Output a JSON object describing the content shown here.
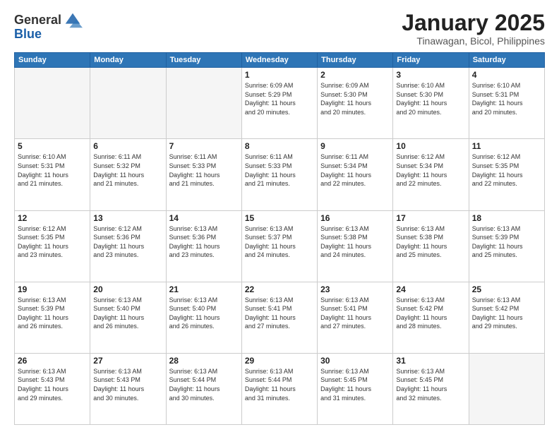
{
  "header": {
    "logo_general": "General",
    "logo_blue": "Blue",
    "month_title": "January 2025",
    "location": "Tinawagan, Bicol, Philippines"
  },
  "weekdays": [
    "Sunday",
    "Monday",
    "Tuesday",
    "Wednesday",
    "Thursday",
    "Friday",
    "Saturday"
  ],
  "weeks": [
    [
      {
        "day": "",
        "info": ""
      },
      {
        "day": "",
        "info": ""
      },
      {
        "day": "",
        "info": ""
      },
      {
        "day": "1",
        "info": "Sunrise: 6:09 AM\nSunset: 5:29 PM\nDaylight: 11 hours\nand 20 minutes."
      },
      {
        "day": "2",
        "info": "Sunrise: 6:09 AM\nSunset: 5:30 PM\nDaylight: 11 hours\nand 20 minutes."
      },
      {
        "day": "3",
        "info": "Sunrise: 6:10 AM\nSunset: 5:30 PM\nDaylight: 11 hours\nand 20 minutes."
      },
      {
        "day": "4",
        "info": "Sunrise: 6:10 AM\nSunset: 5:31 PM\nDaylight: 11 hours\nand 20 minutes."
      }
    ],
    [
      {
        "day": "5",
        "info": "Sunrise: 6:10 AM\nSunset: 5:31 PM\nDaylight: 11 hours\nand 21 minutes."
      },
      {
        "day": "6",
        "info": "Sunrise: 6:11 AM\nSunset: 5:32 PM\nDaylight: 11 hours\nand 21 minutes."
      },
      {
        "day": "7",
        "info": "Sunrise: 6:11 AM\nSunset: 5:33 PM\nDaylight: 11 hours\nand 21 minutes."
      },
      {
        "day": "8",
        "info": "Sunrise: 6:11 AM\nSunset: 5:33 PM\nDaylight: 11 hours\nand 21 minutes."
      },
      {
        "day": "9",
        "info": "Sunrise: 6:11 AM\nSunset: 5:34 PM\nDaylight: 11 hours\nand 22 minutes."
      },
      {
        "day": "10",
        "info": "Sunrise: 6:12 AM\nSunset: 5:34 PM\nDaylight: 11 hours\nand 22 minutes."
      },
      {
        "day": "11",
        "info": "Sunrise: 6:12 AM\nSunset: 5:35 PM\nDaylight: 11 hours\nand 22 minutes."
      }
    ],
    [
      {
        "day": "12",
        "info": "Sunrise: 6:12 AM\nSunset: 5:35 PM\nDaylight: 11 hours\nand 23 minutes."
      },
      {
        "day": "13",
        "info": "Sunrise: 6:12 AM\nSunset: 5:36 PM\nDaylight: 11 hours\nand 23 minutes."
      },
      {
        "day": "14",
        "info": "Sunrise: 6:13 AM\nSunset: 5:36 PM\nDaylight: 11 hours\nand 23 minutes."
      },
      {
        "day": "15",
        "info": "Sunrise: 6:13 AM\nSunset: 5:37 PM\nDaylight: 11 hours\nand 24 minutes."
      },
      {
        "day": "16",
        "info": "Sunrise: 6:13 AM\nSunset: 5:38 PM\nDaylight: 11 hours\nand 24 minutes."
      },
      {
        "day": "17",
        "info": "Sunrise: 6:13 AM\nSunset: 5:38 PM\nDaylight: 11 hours\nand 25 minutes."
      },
      {
        "day": "18",
        "info": "Sunrise: 6:13 AM\nSunset: 5:39 PM\nDaylight: 11 hours\nand 25 minutes."
      }
    ],
    [
      {
        "day": "19",
        "info": "Sunrise: 6:13 AM\nSunset: 5:39 PM\nDaylight: 11 hours\nand 26 minutes."
      },
      {
        "day": "20",
        "info": "Sunrise: 6:13 AM\nSunset: 5:40 PM\nDaylight: 11 hours\nand 26 minutes."
      },
      {
        "day": "21",
        "info": "Sunrise: 6:13 AM\nSunset: 5:40 PM\nDaylight: 11 hours\nand 26 minutes."
      },
      {
        "day": "22",
        "info": "Sunrise: 6:13 AM\nSunset: 5:41 PM\nDaylight: 11 hours\nand 27 minutes."
      },
      {
        "day": "23",
        "info": "Sunrise: 6:13 AM\nSunset: 5:41 PM\nDaylight: 11 hours\nand 27 minutes."
      },
      {
        "day": "24",
        "info": "Sunrise: 6:13 AM\nSunset: 5:42 PM\nDaylight: 11 hours\nand 28 minutes."
      },
      {
        "day": "25",
        "info": "Sunrise: 6:13 AM\nSunset: 5:42 PM\nDaylight: 11 hours\nand 29 minutes."
      }
    ],
    [
      {
        "day": "26",
        "info": "Sunrise: 6:13 AM\nSunset: 5:43 PM\nDaylight: 11 hours\nand 29 minutes."
      },
      {
        "day": "27",
        "info": "Sunrise: 6:13 AM\nSunset: 5:43 PM\nDaylight: 11 hours\nand 30 minutes."
      },
      {
        "day": "28",
        "info": "Sunrise: 6:13 AM\nSunset: 5:44 PM\nDaylight: 11 hours\nand 30 minutes."
      },
      {
        "day": "29",
        "info": "Sunrise: 6:13 AM\nSunset: 5:44 PM\nDaylight: 11 hours\nand 31 minutes."
      },
      {
        "day": "30",
        "info": "Sunrise: 6:13 AM\nSunset: 5:45 PM\nDaylight: 11 hours\nand 31 minutes."
      },
      {
        "day": "31",
        "info": "Sunrise: 6:13 AM\nSunset: 5:45 PM\nDaylight: 11 hours\nand 32 minutes."
      },
      {
        "day": "",
        "info": ""
      }
    ]
  ]
}
